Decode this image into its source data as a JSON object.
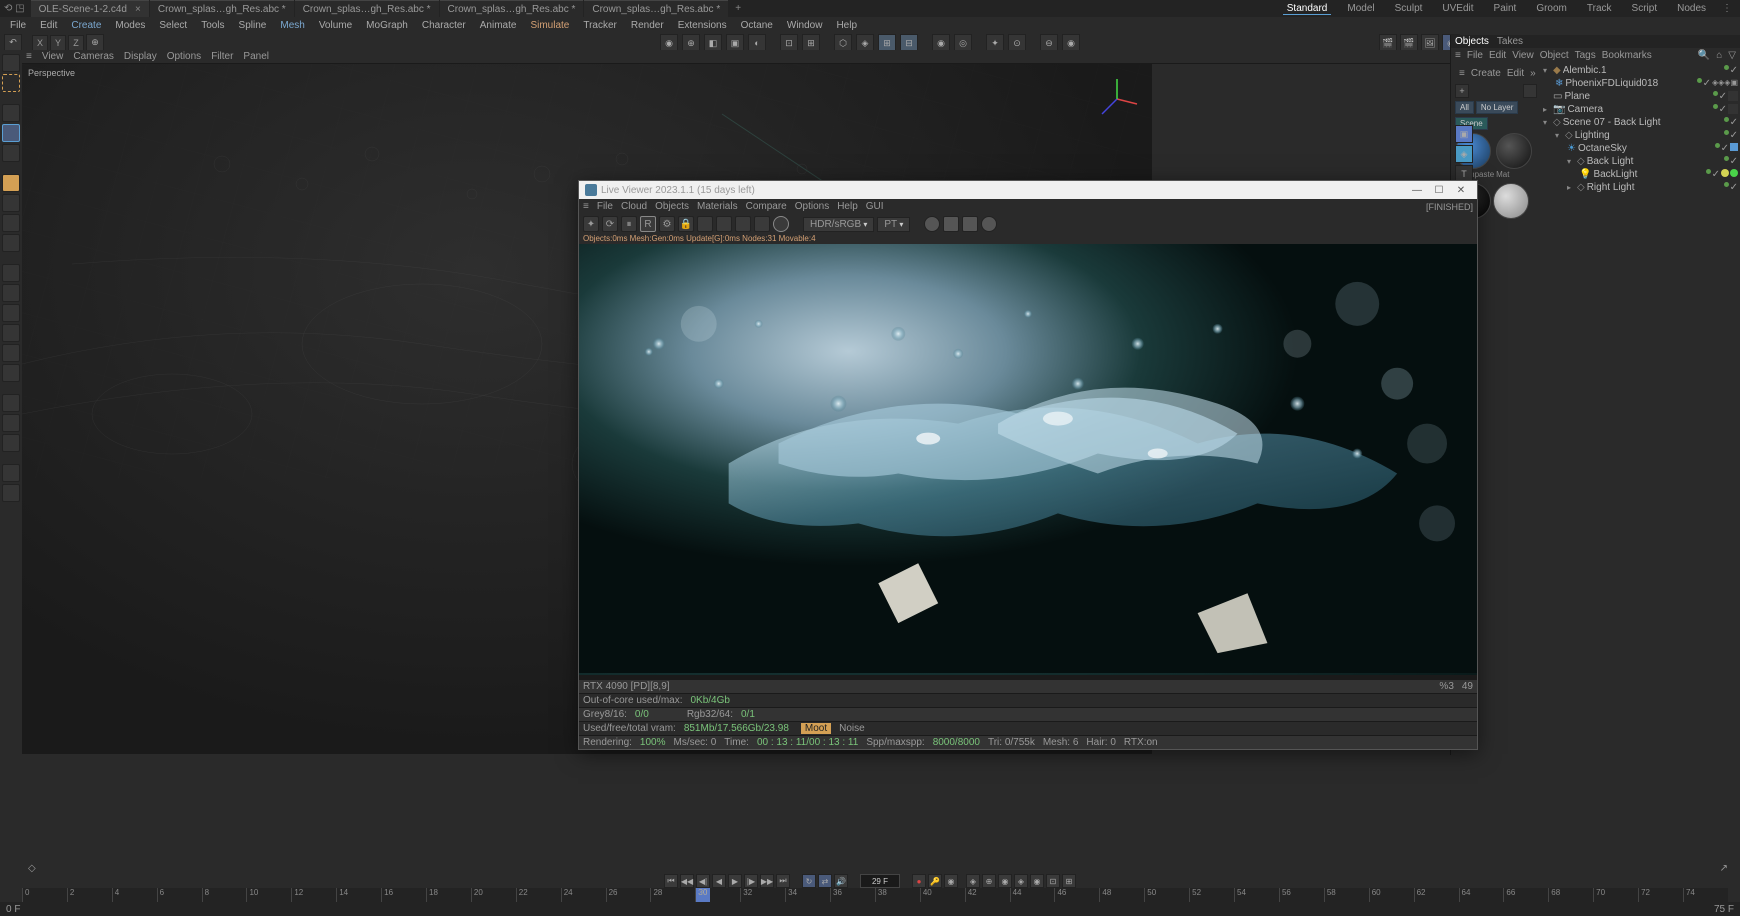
{
  "tabs": [
    {
      "label": "OLE-Scene-1-2.c4d",
      "active": true
    },
    {
      "label": "Crown_splas…gh_Res.abc *",
      "active": false
    },
    {
      "label": "Crown_splas…gh_Res.abc *",
      "active": false
    },
    {
      "label": "Crown_splas…gh_Res.abc *",
      "active": false
    },
    {
      "label": "Crown_splas…gh_Res.abc *",
      "active": false
    }
  ],
  "layout_tabs": [
    "Standard",
    "Model",
    "Sculpt",
    "UVEdit",
    "Paint",
    "Groom",
    "Track",
    "Script",
    "Nodes"
  ],
  "layout_active": "Standard",
  "main_menu": [
    "File",
    "Edit",
    "Create",
    "Modes",
    "Select",
    "Tools",
    "Spline",
    "Mesh",
    "Volume",
    "MoGraph",
    "Character",
    "Animate",
    "Simulate",
    "Tracker",
    "Render",
    "Extensions",
    "Octane",
    "Window",
    "Help"
  ],
  "menu_highlights": {
    "Create": "highlight",
    "Mesh": "highlight",
    "Simulate": "orange"
  },
  "axis_labels": [
    "X",
    "Y",
    "Z"
  ],
  "viewport_menu": [
    "View",
    "Cameras",
    "Display",
    "Options",
    "Filter",
    "Panel"
  ],
  "viewport_title": "Perspective",
  "right_panel": {
    "tab1": "Objects",
    "tab2": "Takes",
    "menu": [
      "File",
      "Edit",
      "View",
      "Object",
      "Tags",
      "Bookmarks"
    ]
  },
  "tag_buttons": {
    "all": "All",
    "nolayer": "No Layer",
    "scene": "Scene"
  },
  "materials": [
    {
      "name": "Toothpaste"
    },
    {
      "name": "Mat"
    }
  ],
  "objects": [
    {
      "name": "Alembic.1",
      "indent": 0,
      "expanded": true
    },
    {
      "name": "PhoenixFDLiquid018",
      "indent": 1,
      "expanded": false
    },
    {
      "name": "Plane",
      "indent": 0,
      "expanded": false
    },
    {
      "name": "Camera",
      "indent": 0,
      "expanded": false
    },
    {
      "name": "Scene 07 - Back Light",
      "indent": 0,
      "expanded": true
    },
    {
      "name": "Lighting",
      "indent": 1,
      "expanded": true
    },
    {
      "name": "OctaneSky",
      "indent": 2,
      "expanded": false
    },
    {
      "name": "Back Light",
      "indent": 2,
      "expanded": true
    },
    {
      "name": "BackLight",
      "indent": 3,
      "expanded": false
    },
    {
      "name": "Right Light",
      "indent": 2,
      "expanded": false
    }
  ],
  "left_menu": [
    "Create",
    "Edit"
  ],
  "live_viewer": {
    "title": "Live Viewer 2023.1.1 (15 days left)",
    "menu": [
      "File",
      "Cloud",
      "Objects",
      "Materials",
      "Compare",
      "Options",
      "Help",
      "GUI"
    ],
    "status": "[FINISHED]",
    "dropdown1": "HDR/sRGB",
    "dropdown2": "PT",
    "info_line": "Objects:0ms Mesh:Gen:0ms Update[G]:0ms Nodes:31 Movable:4",
    "stats": {
      "gpu": "RTX 4090 [PD][8,9]",
      "gpu_pct": "%3",
      "gpu_num": "49",
      "ooc_label": "Out-of-core used/max:",
      "ooc_val": "0Kb/4Gb",
      "grey_label": "Grey8/16:",
      "grey_val": "0/0",
      "rgb_label": "Rgb32/64:",
      "rgb_val": "0/1",
      "vram_label": "Used/free/total vram:",
      "vram_val": "851Mb/17.566Gb/23.98",
      "moot": "Moot",
      "noise": "Noise",
      "render_label": "Rendering:",
      "render_pct": "100%",
      "mssec": "Ms/sec: 0",
      "time_label": "Time:",
      "time_val": "00 : 13 : 11/00 : 13 : 11",
      "spp_label": "Spp/maxspp:",
      "spp_val": "8000/8000",
      "tri": "Tri: 0/755k",
      "mesh": "Mesh: 6",
      "hair": "Hair: 0",
      "rtx": "RTX:on"
    }
  },
  "timeline": {
    "start": 0,
    "end": 75,
    "current": 29,
    "current_display": "29 F",
    "playhead_label": "30",
    "ticks": [
      "0",
      "2",
      "4",
      "6",
      "8",
      "10",
      "12",
      "14",
      "16",
      "18",
      "20",
      "22",
      "24",
      "26",
      "28",
      "30",
      "32",
      "34",
      "36",
      "38",
      "40",
      "42",
      "44",
      "46",
      "48",
      "50",
      "52",
      "54",
      "56",
      "58",
      "60",
      "62",
      "64",
      "66",
      "68",
      "70",
      "72",
      "74"
    ]
  },
  "statusbar": {
    "left": "0 F",
    "right": "75 F"
  }
}
